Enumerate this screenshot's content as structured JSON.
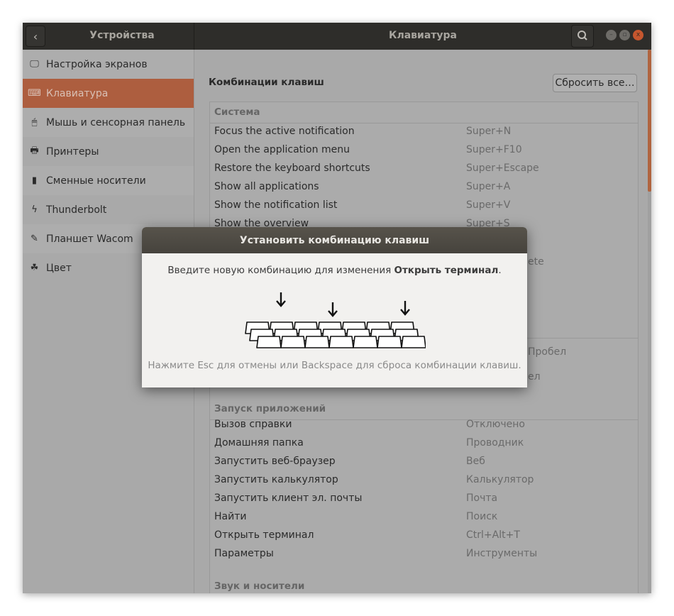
{
  "header": {
    "left_title": "Устройства",
    "title": "Клавиатура",
    "back_icon": "chevron-left-icon",
    "search_icon": "search-icon"
  },
  "sidebar": {
    "items": [
      {
        "label": "Настройка экранов",
        "icon": "display-icon",
        "glyph": "🖵"
      },
      {
        "label": "Клавиатура",
        "icon": "keyboard-icon",
        "glyph": "⌨",
        "selected": true
      },
      {
        "label": "Мышь и сенсорная панель",
        "icon": "mouse-icon",
        "glyph": "🖱"
      },
      {
        "label": "Принтеры",
        "icon": "printer-icon",
        "glyph": "🖶"
      },
      {
        "label": "Сменные носители",
        "icon": "usb-drive-icon",
        "glyph": "▮"
      },
      {
        "label": "Thunderbolt",
        "icon": "thunderbolt-icon",
        "glyph": "ϟ"
      },
      {
        "label": "Планшет Wacom",
        "icon": "tablet-icon",
        "glyph": "✎"
      },
      {
        "label": "Цвет",
        "icon": "color-icon",
        "glyph": "☘"
      }
    ]
  },
  "main": {
    "section_title": "Комбинации клавиш",
    "reset_label": "Сбросить все…",
    "groups": [
      {
        "title": "Система",
        "rows": [
          {
            "name": "Focus the active notification",
            "value": "Super+N"
          },
          {
            "name": "Open the application menu",
            "value": "Super+F10"
          },
          {
            "name": "Restore the keyboard shortcuts",
            "value": "Super+Escape"
          },
          {
            "name": "Show all applications",
            "value": "Super+A"
          },
          {
            "name": "Show the notification list",
            "value": "Super+V"
          },
          {
            "name": "Show the overview",
            "value": "Super+S"
          }
        ]
      },
      {
        "title": "Запуск приложений",
        "rows": [
          {
            "name": "Вызов справки",
            "value": "Отключено"
          },
          {
            "name": "Домашняя папка",
            "value": "Проводник"
          },
          {
            "name": "Запустить веб-браузер",
            "value": "Веб"
          },
          {
            "name": "Запустить калькулятор",
            "value": "Калькулятор"
          },
          {
            "name": "Запустить клиент эл. почты",
            "value": "Почта"
          },
          {
            "name": "Найти",
            "value": "Поиск"
          },
          {
            "name": "Открыть терминал",
            "value": "Ctrl+Alt+T"
          },
          {
            "name": "Параметры",
            "value": "Инструменты"
          }
        ]
      },
      {
        "title": "Звук и носители",
        "rows": []
      }
    ],
    "hidden_fragments": [
      "ete",
      "Пробел",
      "ел"
    ]
  },
  "dialog": {
    "title": "Установить комбинацию клавиш",
    "message_prefix": "Введите новую комбинацию для изменения ",
    "message_action": "Открыть терминал",
    "message_suffix": ".",
    "hint": "Нажмите Esc для отмены или Backspace для сброса комбинации клавиш."
  },
  "colors": {
    "accent": "#ad5e3f",
    "header": "#2e2d2a",
    "close": "#c5562e"
  }
}
